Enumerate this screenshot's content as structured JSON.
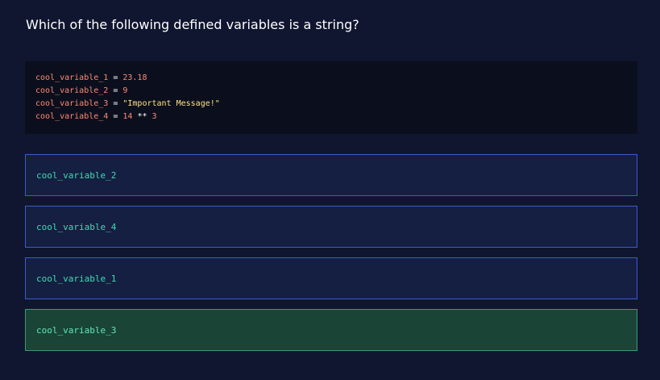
{
  "question": {
    "text": "Which of the following defined variables is a string?"
  },
  "code": {
    "lines": [
      {
        "var": "cool_variable_1",
        "op": " = ",
        "value": "23.18",
        "value_type": "number",
        "rest_op": "",
        "rest": ""
      },
      {
        "var": "cool_variable_2",
        "op": " = ",
        "value": "9",
        "value_type": "number",
        "rest_op": "",
        "rest": ""
      },
      {
        "var": "cool_variable_3",
        "op": " = ",
        "value": "\"Important Message!\"",
        "value_type": "string",
        "rest_op": "",
        "rest": ""
      },
      {
        "var": "cool_variable_4",
        "op": " = ",
        "value": "14",
        "value_type": "number",
        "rest_op": " ** ",
        "rest": "3"
      }
    ]
  },
  "options": [
    {
      "label": "cool_variable_2",
      "state": "default"
    },
    {
      "label": "cool_variable_4",
      "state": "default"
    },
    {
      "label": "cool_variable_1",
      "state": "default"
    },
    {
      "label": "cool_variable_3",
      "state": "correct"
    }
  ],
  "colors": {
    "background": "#10162f",
    "code_background": "#0b0f1d",
    "option_border": "#3a5ccc",
    "option_background": "#151f41",
    "correct_border": "#3c9a6e",
    "correct_background": "#1a4536",
    "option_text": "#3ddbb3",
    "code_variable": "#ff8973",
    "code_string": "#ffe083"
  }
}
